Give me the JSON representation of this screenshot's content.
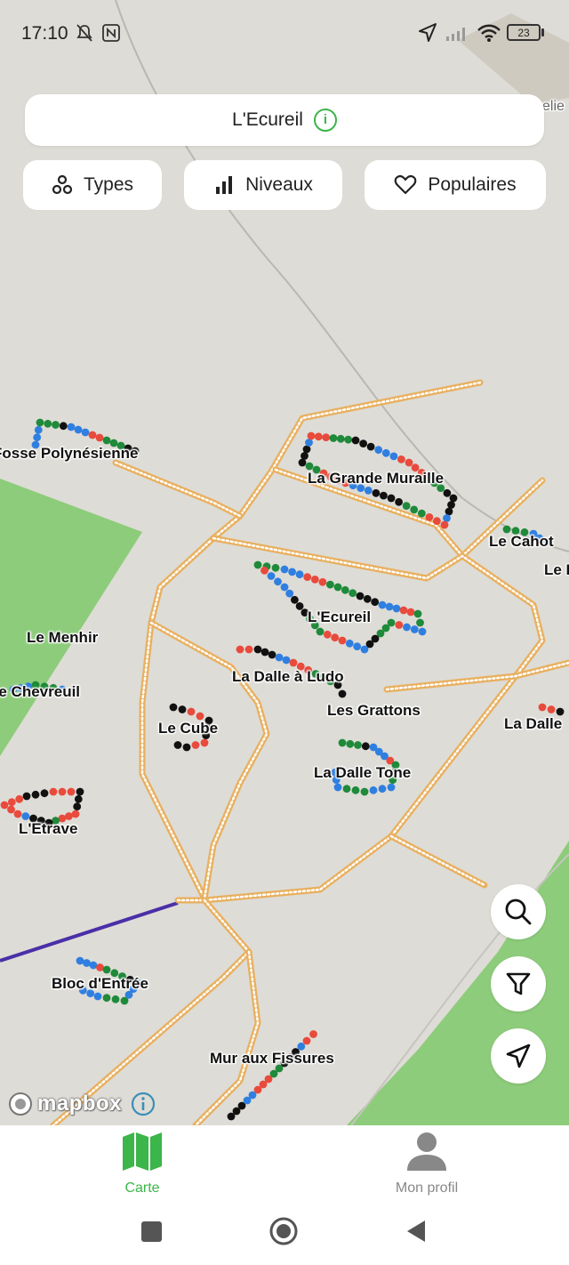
{
  "status_bar": {
    "time": "17:10",
    "battery": "23"
  },
  "search": {
    "title": "L'Ecureil",
    "info_glyph": "i"
  },
  "filters": [
    {
      "label": "Types",
      "icon": "types-icon"
    },
    {
      "label": "Niveaux",
      "icon": "bars-icon"
    },
    {
      "label": "Populaires",
      "icon": "heart-icon"
    }
  ],
  "map": {
    "partial_label_top_right": "elie",
    "boulders": [
      "Fosse Polynésienne",
      "La Grande Muraille",
      "Le Cahot",
      "Le I",
      "L'Ecureil",
      "Le Menhir",
      "La Dalle à Ludo",
      "Le Chevreuil",
      "Les Grattons",
      "La Dalle",
      "Le Cube",
      "La Dalle Tone",
      "L'Etrave",
      "Bloc d'Entrée",
      "Mur aux Fissures"
    ],
    "attribution": "mapbox",
    "colors": {
      "land": "#dedcd6",
      "park": "#8dcc7b",
      "trail": "#e8b060",
      "route": "#4a2fa8"
    }
  },
  "map_controls": [
    {
      "name": "search-button",
      "icon": "search-icon"
    },
    {
      "name": "filter-button",
      "icon": "filter-icon"
    },
    {
      "name": "locate-button",
      "icon": "navigation-arrow-icon"
    }
  ],
  "bottom_nav": [
    {
      "label": "Carte",
      "icon": "map-icon",
      "active": true
    },
    {
      "label": "Mon profil",
      "icon": "user-icon",
      "active": false
    }
  ],
  "accent": "#3cb54a"
}
